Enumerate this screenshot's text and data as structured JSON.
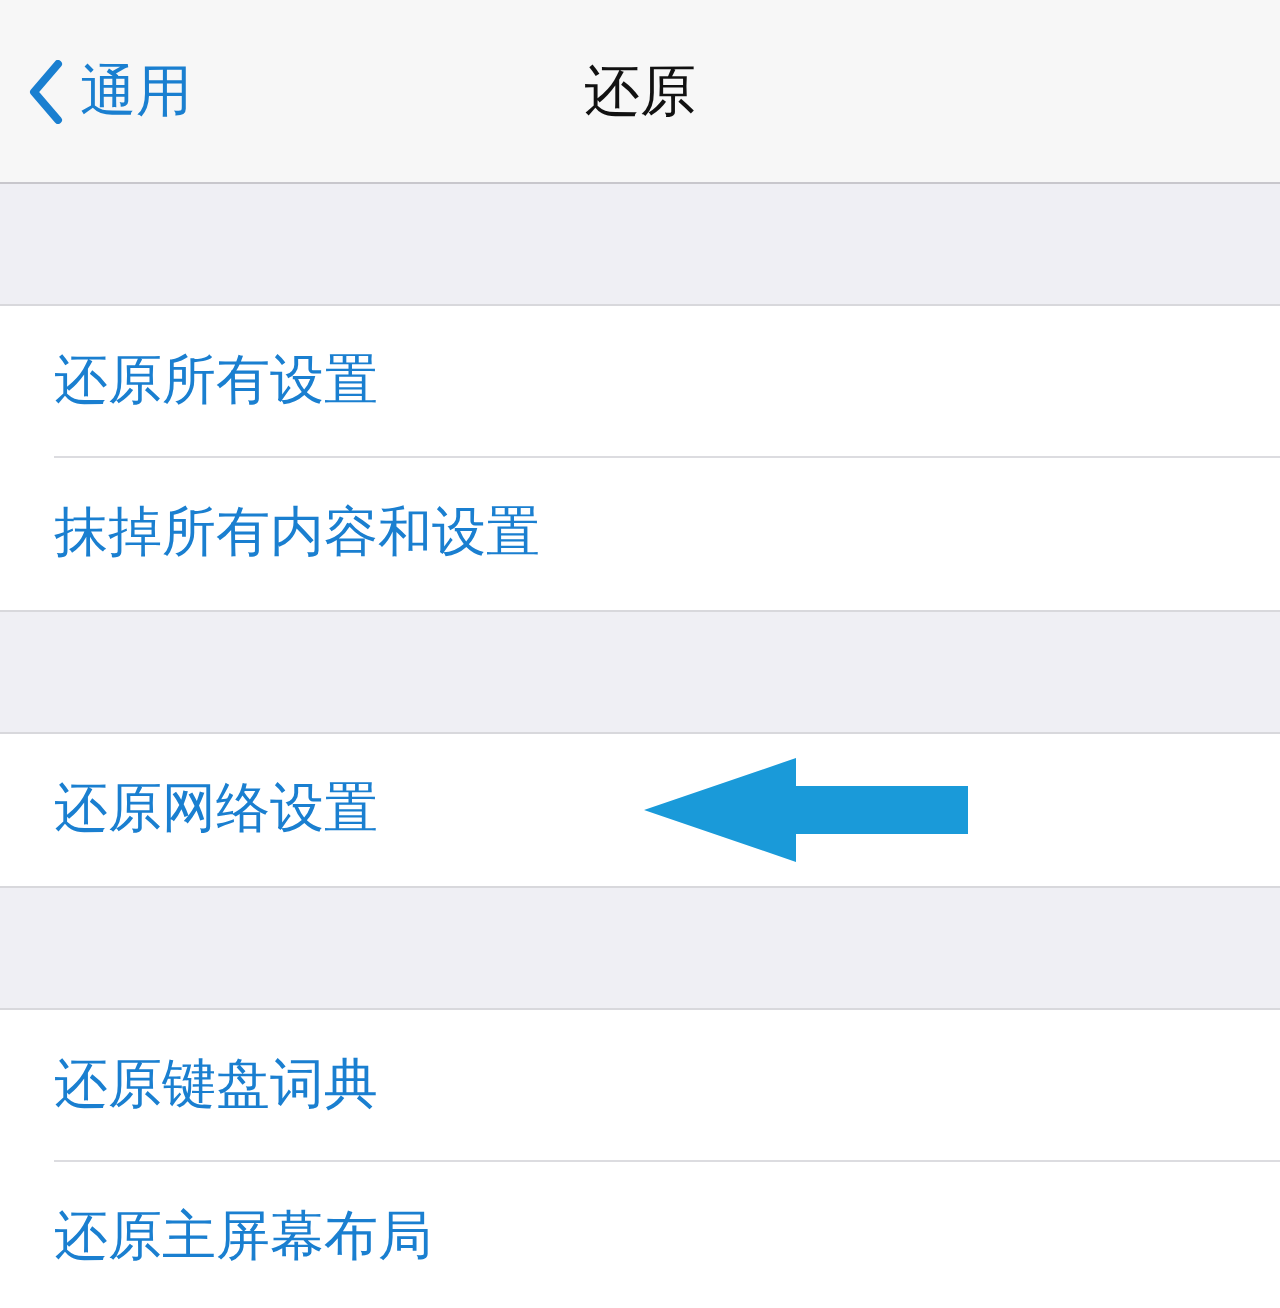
{
  "nav": {
    "back_label": "通用",
    "title": "还原"
  },
  "groups": [
    [
      {
        "label": "还原所有设置",
        "annotated": false
      },
      {
        "label": "抹掉所有内容和设置",
        "annotated": false
      }
    ],
    [
      {
        "label": "还原网络设置",
        "annotated": true
      }
    ],
    [
      {
        "label": "还原键盘词典",
        "annotated": false
      },
      {
        "label": "还原主屏幕布局",
        "annotated": false
      }
    ]
  ]
}
